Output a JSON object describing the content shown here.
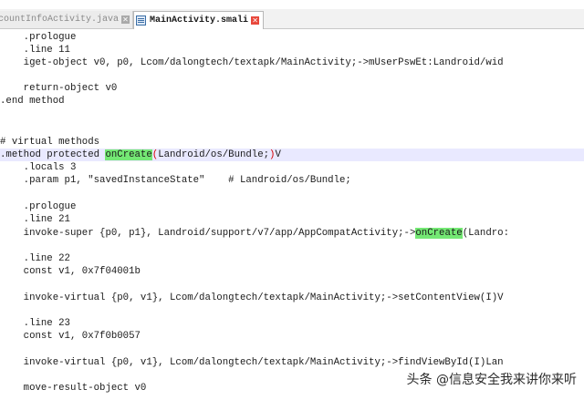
{
  "tabs": [
    {
      "label": "countInfoActivity.java",
      "active": false
    },
    {
      "label": "MainActivity.smali",
      "active": true
    }
  ],
  "editor": {
    "lines": [
      {
        "id": "l1",
        "text": "    .prologue"
      },
      {
        "id": "l2",
        "text": "    .line 11"
      },
      {
        "id": "l3",
        "text": "    iget-object v0, p0, Lcom/dalongtech/textapk/MainActivity;->mUserPswEt:Landroid/wid"
      },
      {
        "id": "l4",
        "text": ""
      },
      {
        "id": "l5",
        "text": "    return-object v0"
      },
      {
        "id": "l6",
        "text": ".end method"
      },
      {
        "id": "l9",
        "text": "# virtual methods"
      },
      {
        "id": "l10",
        "pre": ".method protected ",
        "hl": "onCreate",
        "red1": "(",
        "mid": "Landroid/os/Bundle;",
        "red2": ")",
        "post": "V"
      },
      {
        "id": "l11",
        "text": "    .locals 3"
      },
      {
        "id": "l12",
        "text": "    .param p1, \"savedInstanceState\"    # Landroid/os/Bundle;"
      },
      {
        "id": "l14",
        "text": "    .prologue"
      },
      {
        "id": "l15",
        "text": "    .line 21"
      },
      {
        "id": "l16",
        "pre": "    invoke-super {p0, p1}, Landroid/support/v7/app/AppCompatActivity;->",
        "hl": "onCreate",
        "post": "(Landro:"
      },
      {
        "id": "l18",
        "text": "    .line 22"
      },
      {
        "id": "l19",
        "text": "    const v1, 0x7f04001b"
      },
      {
        "id": "l21",
        "text": "    invoke-virtual {p0, v1}, Lcom/dalongtech/textapk/MainActivity;->setContentView(I)V"
      },
      {
        "id": "l23",
        "text": "    .line 23"
      },
      {
        "id": "l24",
        "text": "    const v1, 0x7f0b0057"
      },
      {
        "id": "l26",
        "text": "    invoke-virtual {p0, v1}, Lcom/dalongtech/textapk/MainActivity;->findViewById(I)Lan"
      },
      {
        "id": "l28",
        "text": "    move-result-object v0"
      }
    ]
  },
  "watermark": "头条 @信息安全我来讲你来听",
  "colors": {
    "highlight": "#74e874",
    "current_line": "#e9e9ff",
    "paren_red": "#d60000",
    "close_active": "#e8473b"
  },
  "icons": [
    "file-icon",
    "close-icon"
  ]
}
